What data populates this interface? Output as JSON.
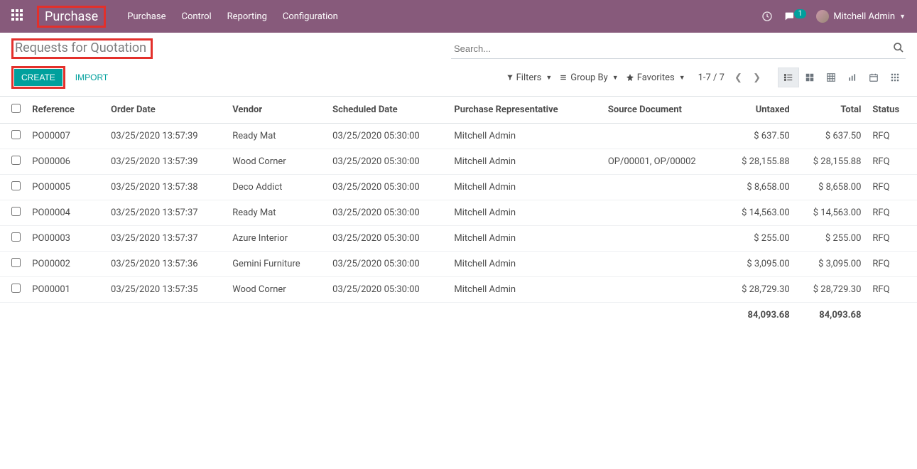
{
  "nav": {
    "brand": "Purchase",
    "items": [
      "Purchase",
      "Control",
      "Reporting",
      "Configuration"
    ],
    "chat_badge": "1",
    "user_name": "Mitchell Admin"
  },
  "breadcrumb": "Requests for Quotation",
  "search": {
    "placeholder": "Search..."
  },
  "buttons": {
    "create": "CREATE",
    "import": "IMPORT"
  },
  "filters": {
    "filters": "Filters",
    "groupby": "Group By",
    "favorites": "Favorites"
  },
  "pager": {
    "range": "1-7 / 7"
  },
  "columns": {
    "reference": "Reference",
    "order_date": "Order Date",
    "vendor": "Vendor",
    "scheduled_date": "Scheduled Date",
    "representative": "Purchase Representative",
    "source": "Source Document",
    "untaxed": "Untaxed",
    "total": "Total",
    "status": "Status"
  },
  "rows": [
    {
      "reference": "PO00007",
      "order_date": "03/25/2020 13:57:39",
      "vendor": "Ready Mat",
      "scheduled_date": "03/25/2020 05:30:00",
      "representative": "Mitchell Admin",
      "source": "",
      "untaxed": "$ 637.50",
      "total": "$ 637.50",
      "status": "RFQ"
    },
    {
      "reference": "PO00006",
      "order_date": "03/25/2020 13:57:39",
      "vendor": "Wood Corner",
      "scheduled_date": "03/25/2020 05:30:00",
      "representative": "Mitchell Admin",
      "source": "OP/00001, OP/00002",
      "untaxed": "$ 28,155.88",
      "total": "$ 28,155.88",
      "status": "RFQ"
    },
    {
      "reference": "PO00005",
      "order_date": "03/25/2020 13:57:38",
      "vendor": "Deco Addict",
      "scheduled_date": "03/25/2020 05:30:00",
      "representative": "Mitchell Admin",
      "source": "",
      "untaxed": "$ 8,658.00",
      "total": "$ 8,658.00",
      "status": "RFQ"
    },
    {
      "reference": "PO00004",
      "order_date": "03/25/2020 13:57:37",
      "vendor": "Ready Mat",
      "scheduled_date": "03/25/2020 05:30:00",
      "representative": "Mitchell Admin",
      "source": "",
      "untaxed": "$ 14,563.00",
      "total": "$ 14,563.00",
      "status": "RFQ"
    },
    {
      "reference": "PO00003",
      "order_date": "03/25/2020 13:57:37",
      "vendor": "Azure Interior",
      "scheduled_date": "03/25/2020 05:30:00",
      "representative": "Mitchell Admin",
      "source": "",
      "untaxed": "$ 255.00",
      "total": "$ 255.00",
      "status": "RFQ"
    },
    {
      "reference": "PO00002",
      "order_date": "03/25/2020 13:57:36",
      "vendor": "Gemini Furniture",
      "scheduled_date": "03/25/2020 05:30:00",
      "representative": "Mitchell Admin",
      "source": "",
      "untaxed": "$ 3,095.00",
      "total": "$ 3,095.00",
      "status": "RFQ"
    },
    {
      "reference": "PO00001",
      "order_date": "03/25/2020 13:57:35",
      "vendor": "Wood Corner",
      "scheduled_date": "03/25/2020 05:30:00",
      "representative": "Mitchell Admin",
      "source": "",
      "untaxed": "$ 28,729.30",
      "total": "$ 28,729.30",
      "status": "RFQ"
    }
  ],
  "totals": {
    "untaxed": "84,093.68",
    "total": "84,093.68"
  }
}
